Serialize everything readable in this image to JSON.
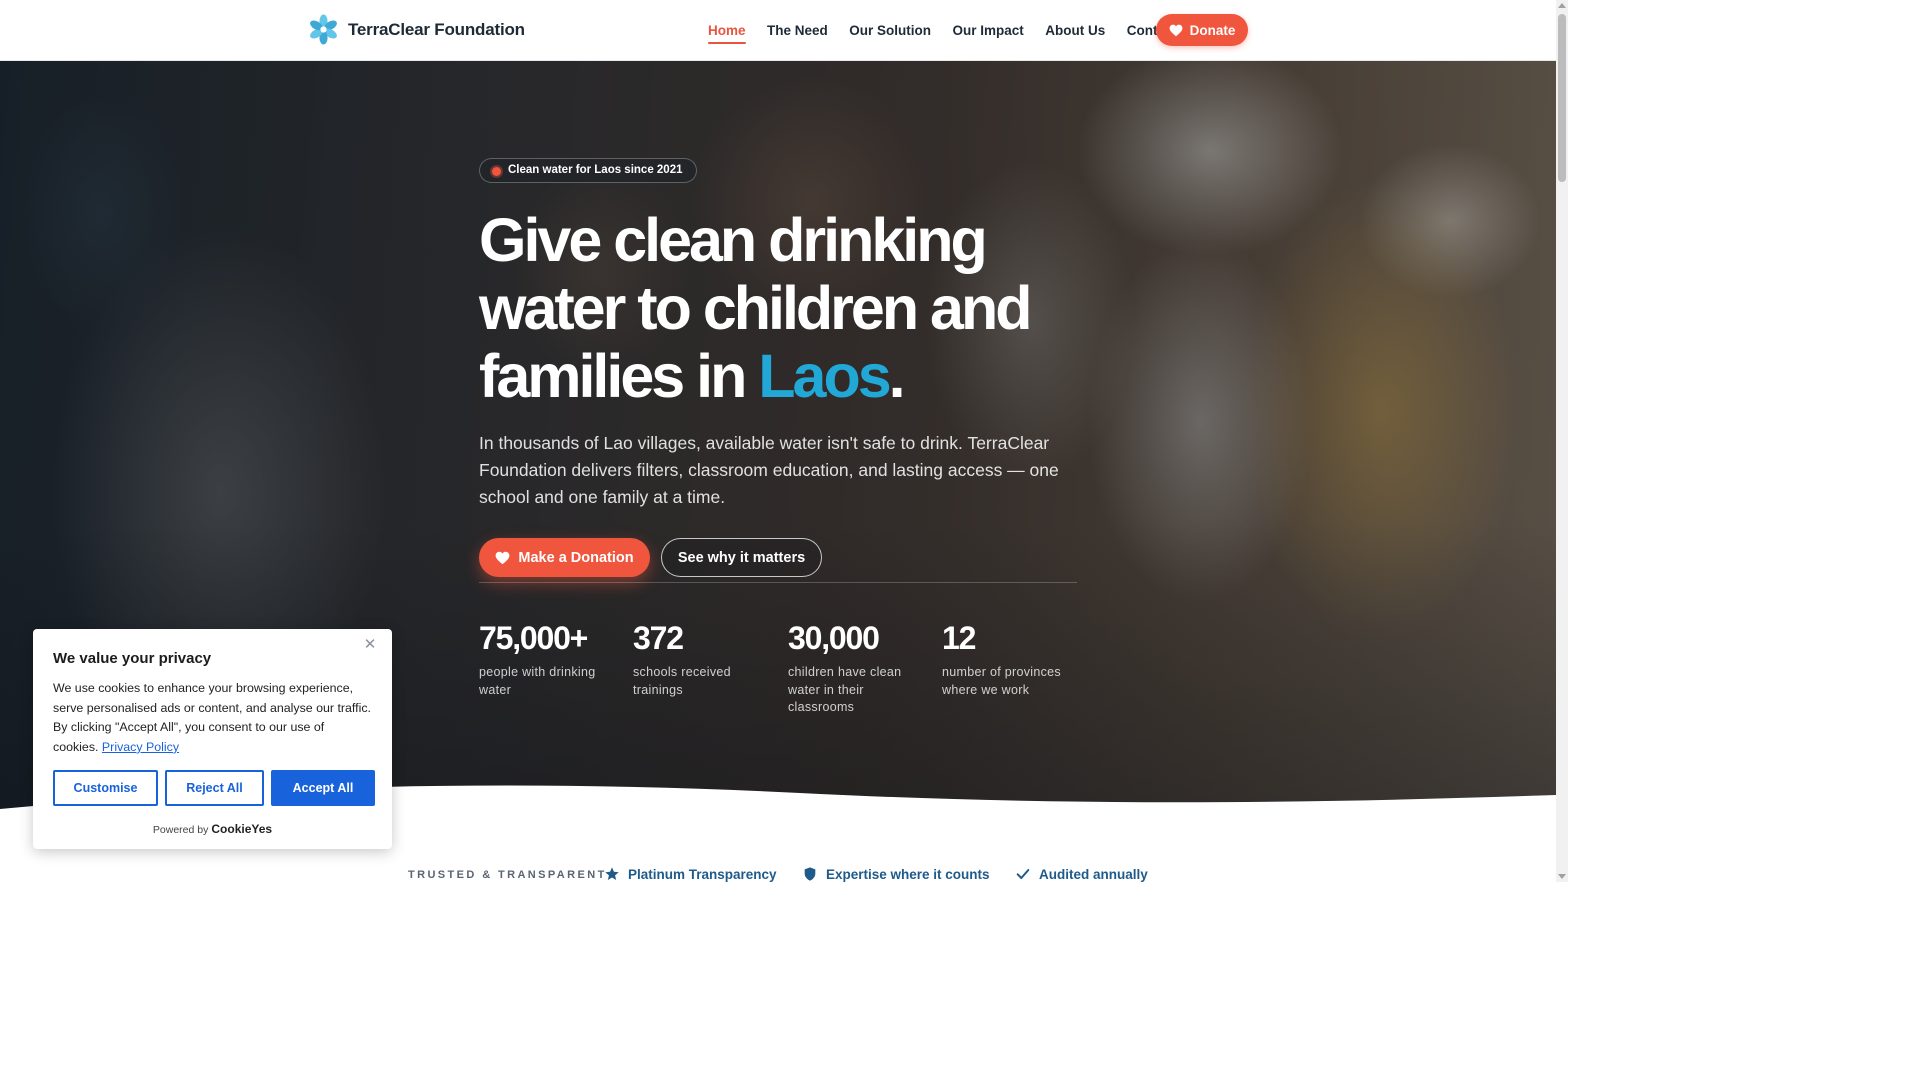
{
  "brand": {
    "name": "TerraClear Foundation",
    "logo_icon": "water-flower-icon"
  },
  "nav": {
    "items": [
      {
        "label": "Home",
        "active": true
      },
      {
        "label": "The Need",
        "active": false
      },
      {
        "label": "Our Solution",
        "active": false
      },
      {
        "label": "Our Impact",
        "active": false
      },
      {
        "label": "About Us",
        "active": false
      },
      {
        "label": "Contact",
        "active": false
      }
    ],
    "donate_label": "Donate"
  },
  "hero": {
    "badge": "Clean water for Laos since 2021",
    "headline_main": "Give clean drinking water to children and families in ",
    "headline_accent": "Laos",
    "headline_end": ".",
    "lead": "In thousands of Lao villages, available water isn't safe to drink. TerraClear Foundation delivers filters, classroom education, and lasting access — one school and one family at a time.",
    "primary_cta": "Make a Donation",
    "secondary_cta": "See why it matters",
    "stats": [
      {
        "value": "75,000+",
        "label": "people with drinking water"
      },
      {
        "value": "372",
        "label": "schools received trainings"
      },
      {
        "value": "30,000",
        "label": "children have clean water in their classrooms"
      },
      {
        "value": "12",
        "label": "number of provinces where we work"
      }
    ]
  },
  "trust": {
    "title": "TRUSTED & TRANSPARENT",
    "items": [
      {
        "label": "Platinum Transparency",
        "icon": "star-icon"
      },
      {
        "label": "Expertise where it counts",
        "icon": "shield-icon"
      },
      {
        "label": "Audited annually",
        "icon": "check-icon"
      }
    ]
  },
  "cookie": {
    "title": "We value your privacy",
    "text": "We use cookies to enhance your browsing experience, serve personalised ads or content, and analyse our traffic. By clicking \"Accept All\", you consent to our use of cookies.",
    "link": "Privacy Policy",
    "customise": "Customise",
    "reject": "Reject All",
    "accept": "Accept All",
    "powered_by": "Powered by",
    "powered_brand": "CookieYes",
    "close_icon": "close-icon"
  },
  "colors": {
    "accent": "#f0563e",
    "highlight": "#22a8d6",
    "cookie_blue": "#1863dc",
    "trust_blue": "#1e5a8a"
  }
}
